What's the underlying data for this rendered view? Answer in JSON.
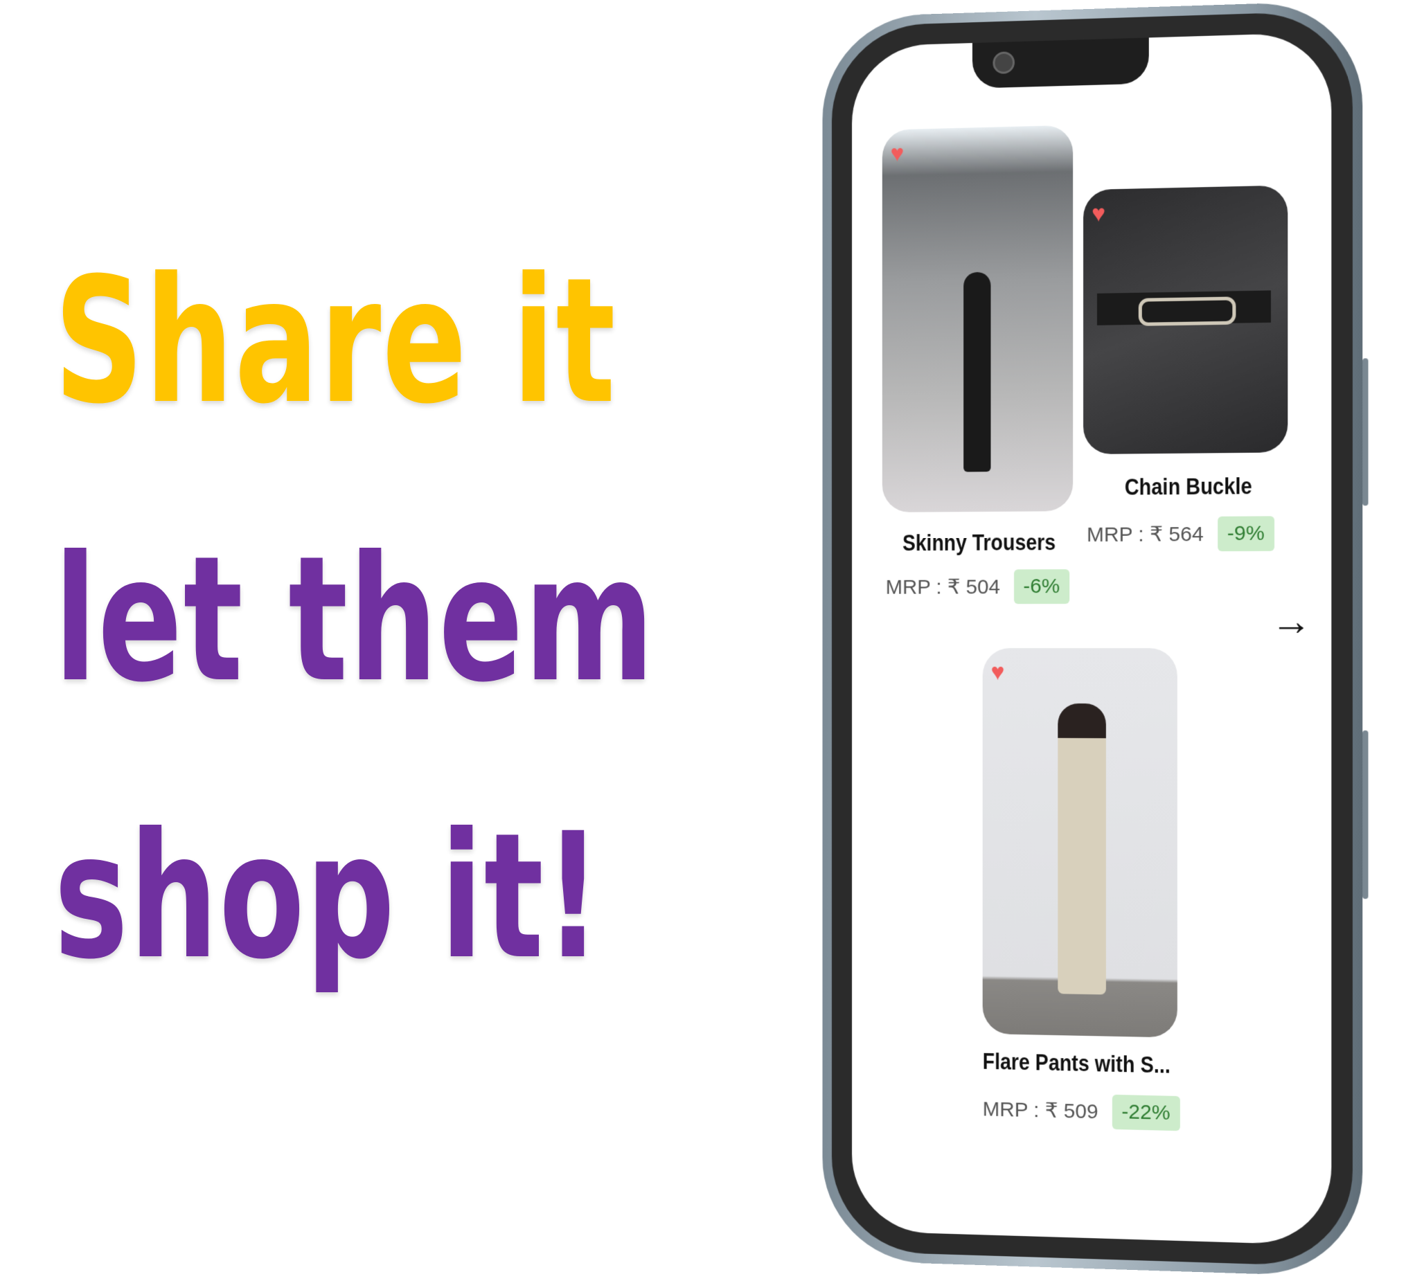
{
  "slogan": {
    "line1": "Share it",
    "line2": "let them",
    "line3": "shop it!"
  },
  "colors": {
    "yellow": "#ffc400",
    "purple": "#7030a0",
    "badge_bg": "#cdeccb",
    "badge_text": "#2f7d32"
  },
  "products": [
    {
      "title": "Skinny Trousers",
      "price": "MRP : ₹ 504",
      "discount": "-6%",
      "icon": "heart-icon"
    },
    {
      "title": "Chain Buckle",
      "price": "MRP : ₹ 564",
      "discount": "-9%",
      "icon": "heart-icon"
    },
    {
      "title": "Flare Pants with S...",
      "price": "MRP : ₹ 509",
      "discount": "-22%",
      "icon": "heart-icon"
    }
  ],
  "next_icon": "arrow-right-icon",
  "glyphs": {
    "heart": "♥",
    "arrow": "→"
  }
}
